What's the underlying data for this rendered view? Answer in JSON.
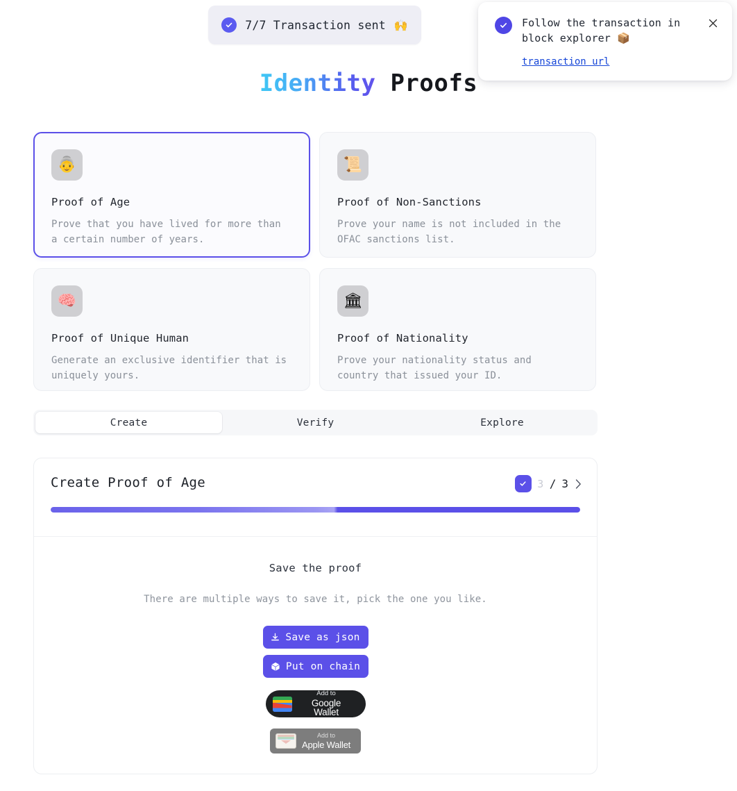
{
  "toast": {
    "icon": "check-circle-icon",
    "text": "7/7 Transaction sent",
    "emoji": "🙌"
  },
  "notification": {
    "icon": "check-circle-icon",
    "text": "Follow the transaction in block explorer 📦",
    "link_label": "transaction url",
    "close_icon": "close-icon"
  },
  "header": {
    "title_accent": "Identity",
    "title_plain": "Proofs",
    "accent_color": "#3fc8f5"
  },
  "proof_cards": [
    {
      "icon": "older-person-emoji",
      "emoji": "👵",
      "title": "Proof of Age",
      "description": "Prove that you have lived for more than a certain number of years.",
      "selected": true
    },
    {
      "icon": "scroll-emoji",
      "emoji": "📜",
      "title": "Proof of Non-Sanctions",
      "description": "Prove your name is not included in the OFAC sanctions list.",
      "selected": false
    },
    {
      "icon": "brain-emoji",
      "emoji": "🧠",
      "title": "Proof of Unique Human",
      "description": "Generate an exclusive identifier that is uniquely yours.",
      "selected": false
    },
    {
      "icon": "classical-building-emoji",
      "emoji": "🏛",
      "title": "Proof of Nationality",
      "description": "Prove your nationality status and country that issued your ID.",
      "selected": false
    }
  ],
  "tabs": [
    {
      "label": "Create",
      "active": true
    },
    {
      "label": "Verify",
      "active": false
    },
    {
      "label": "Explore",
      "active": false
    }
  ],
  "panel": {
    "title": "Create Proof of Age",
    "stepper": {
      "done_icon": "check-icon",
      "current_step": "3",
      "separator": "/",
      "total_steps": "3",
      "next_icon": "chevron-right-icon"
    },
    "progress_percent": 100,
    "body": {
      "heading": "Save the proof",
      "subtext": "There are multiple ways to save it, pick the one you like.",
      "buttons": [
        {
          "icon": "download-icon",
          "label": "Save as json"
        },
        {
          "icon": "cube-icon",
          "label": "Put on chain"
        }
      ],
      "google_wallet": {
        "add_to": "Add to",
        "name": "Google Wallet"
      },
      "apple_wallet": {
        "add_to": "Add to",
        "name": "Apple Wallet"
      }
    }
  },
  "theme": {
    "primary": "#5b50e8",
    "link": "#1646d8",
    "tile_bg": "#cfcfd2",
    "card_bg": "#f8f9fb"
  }
}
